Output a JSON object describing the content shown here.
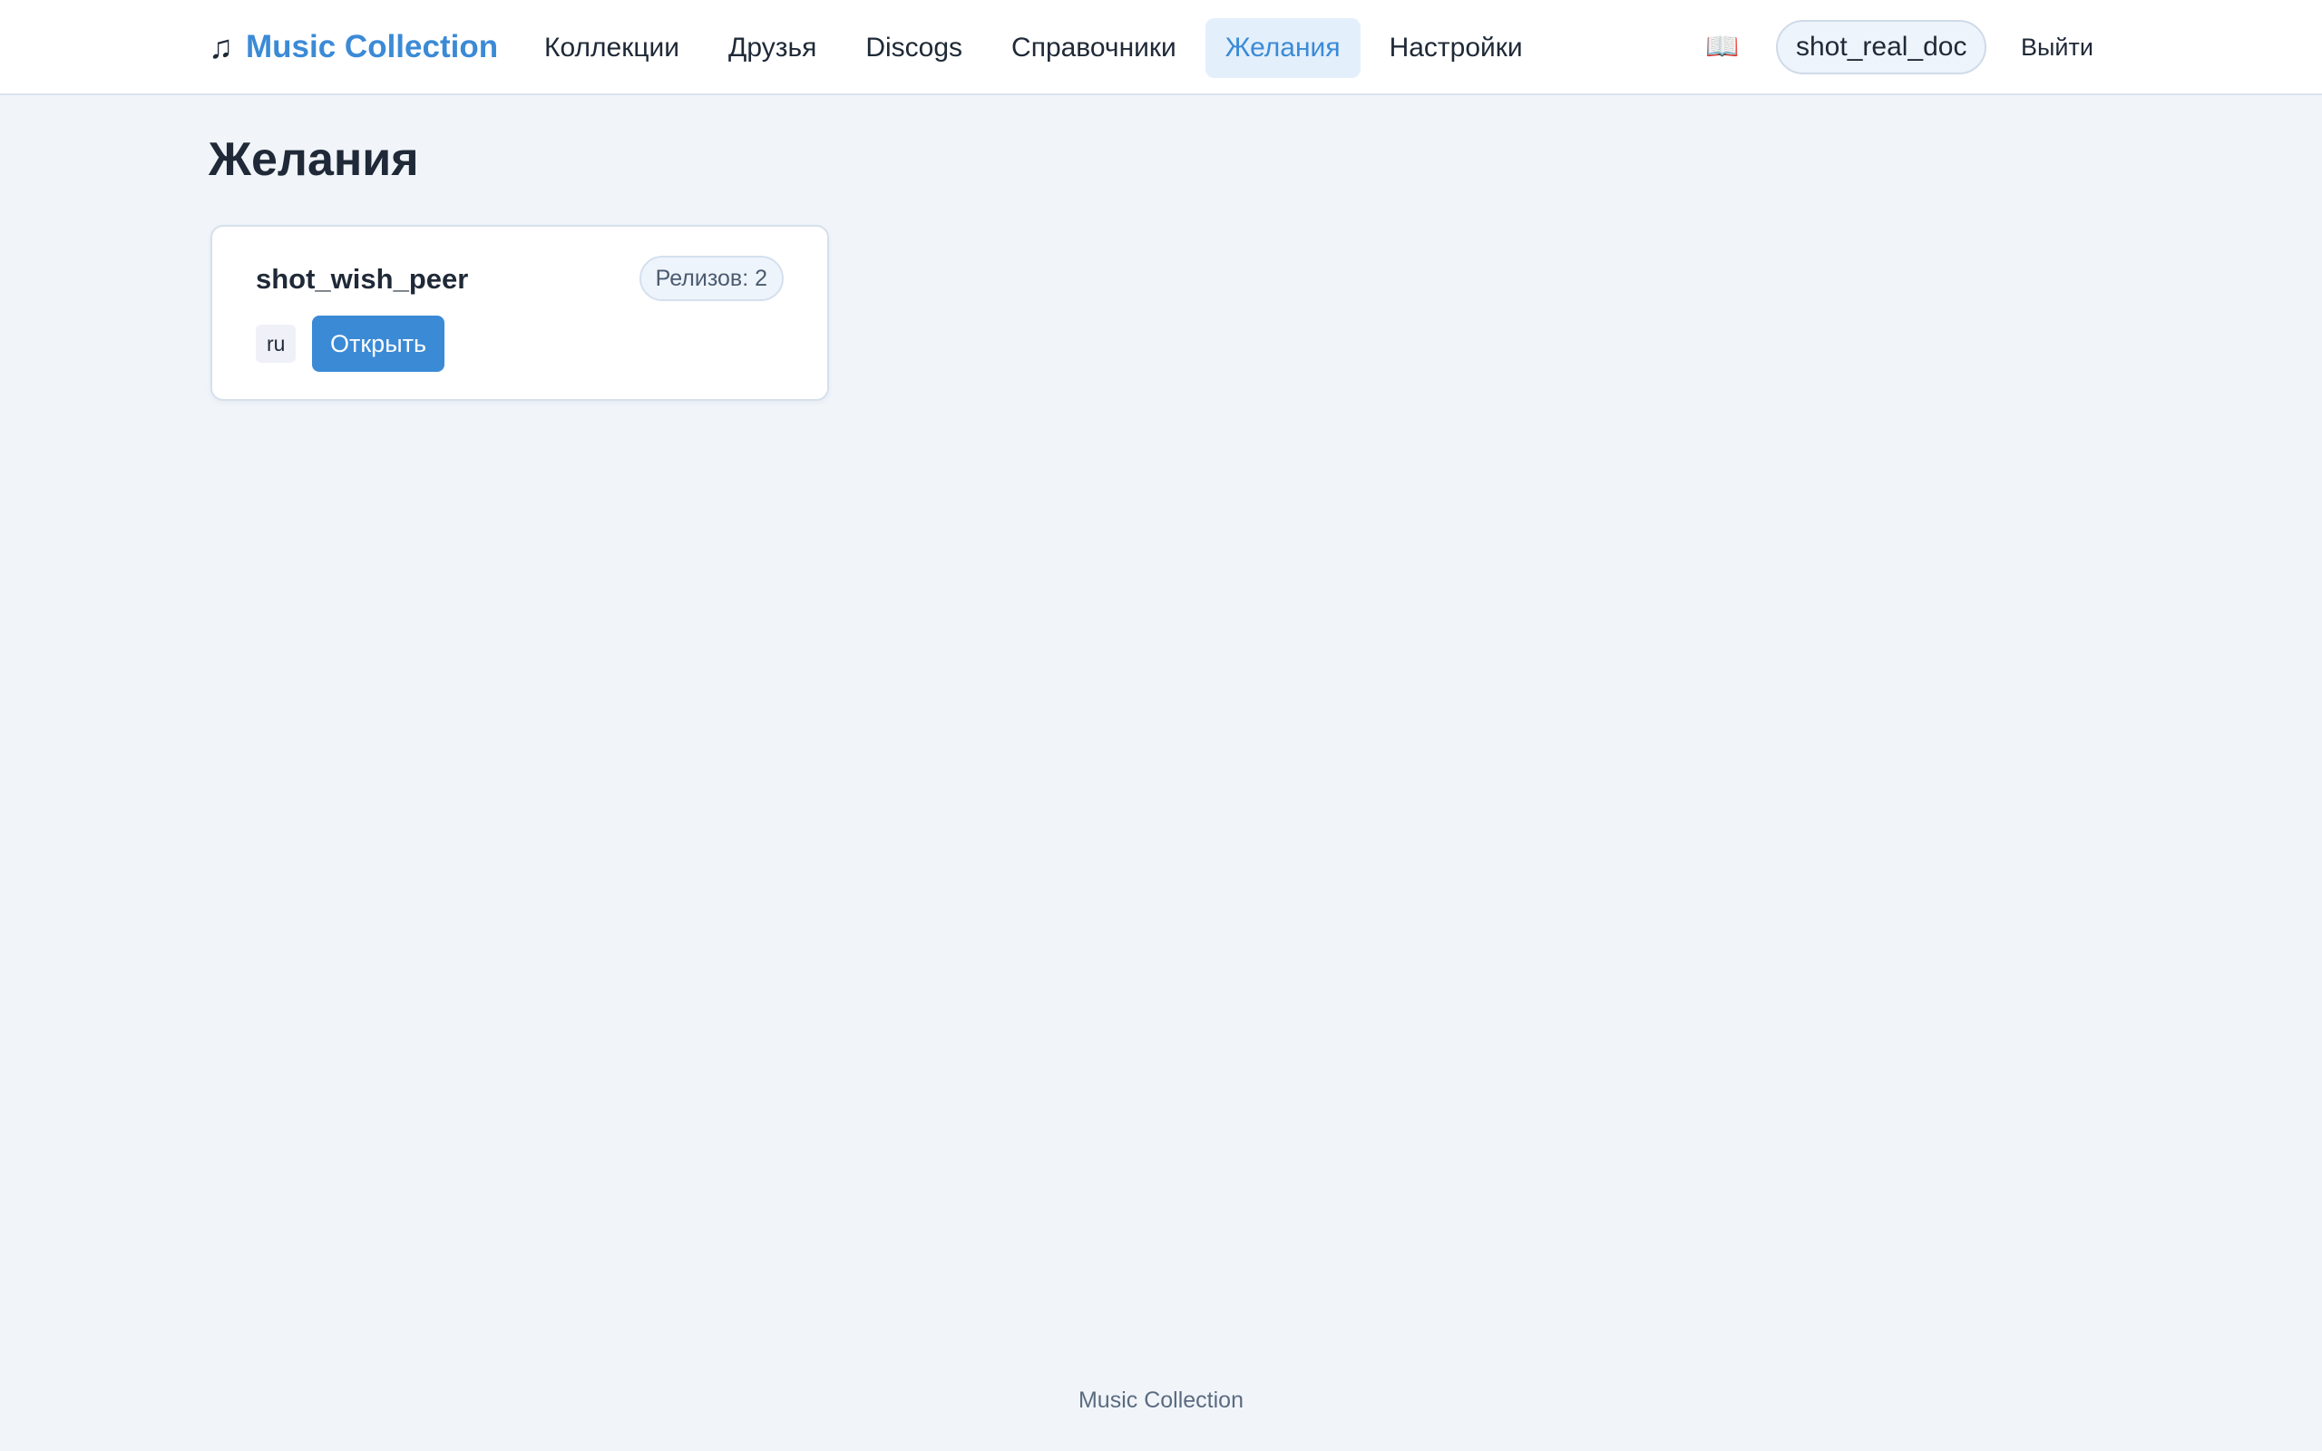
{
  "header": {
    "brand_icon": "♫",
    "brand_title": "Music Collection",
    "nav": [
      {
        "label": "Коллекции",
        "active": false
      },
      {
        "label": "Друзья",
        "active": false
      },
      {
        "label": "Discogs",
        "active": false
      },
      {
        "label": "Справочники",
        "active": false
      },
      {
        "label": "Желания",
        "active": true
      },
      {
        "label": "Настройки",
        "active": false
      }
    ],
    "book_icon": "📖",
    "username": "shot_real_doc",
    "logout_label": "Выйти"
  },
  "main": {
    "title": "Желания",
    "cards": [
      {
        "name": "shot_wish_peer",
        "releases_badge": "Релизов: 2",
        "lang": "ru",
        "open_label": "Открыть"
      }
    ]
  },
  "footer": {
    "text": "Music Collection"
  },
  "colors": {
    "accent": "#3b8ad6",
    "background": "#f1f5fa",
    "active_nav_bg": "#e3effb"
  }
}
